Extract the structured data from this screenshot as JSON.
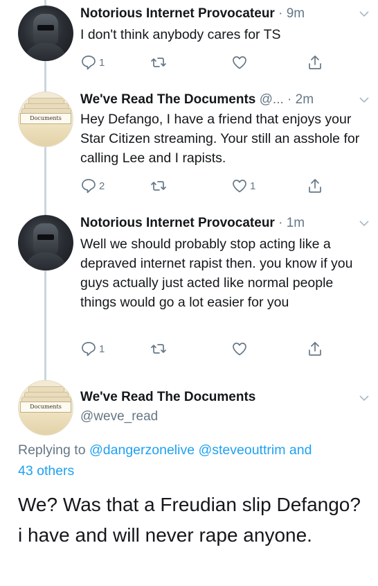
{
  "tweets": [
    {
      "name": "Notorious Internet Provocateur",
      "time": "· 9m",
      "text": "I don't think anybody cares for TS",
      "replies": "1",
      "retweets": "",
      "likes": ""
    },
    {
      "name": "We've Read The Documents",
      "handle_trunc": "@...",
      "time": "· 2m",
      "text": "Hey Defango, I have a friend that enjoys your Star Citizen streaming. Your still an asshole for calling Lee and I rapists.",
      "replies": "2",
      "retweets": "",
      "likes": "1",
      "avatar_text": "Documents"
    },
    {
      "name": "Notorious Internet Provocateur",
      "time": "· 1m",
      "text": "Well we should probably stop acting like a depraved internet rapist then. you know if you guys actually just acted like normal people things would go a lot easier for you",
      "replies": "1",
      "retweets": "",
      "likes": ""
    }
  ],
  "main_tweet": {
    "name": "We've Read The Documents",
    "handle": "@weve_read",
    "avatar_text": "Documents",
    "replying_prefix": "Replying to",
    "replying_to": [
      "@dangerzonelive",
      "@steveouttrim"
    ],
    "replying_and": "and",
    "replying_others": "43 others",
    "text": "We? Was that a Freudian slip Defango? i have and will never rape anyone."
  },
  "colors": {
    "text": "#14171a",
    "secondary": "#657786",
    "link": "#1da1f2",
    "thread_line": "#ccd6dd"
  },
  "icons": [
    "reply-icon",
    "retweet-icon",
    "like-icon",
    "share-icon",
    "chevron-down-icon"
  ]
}
